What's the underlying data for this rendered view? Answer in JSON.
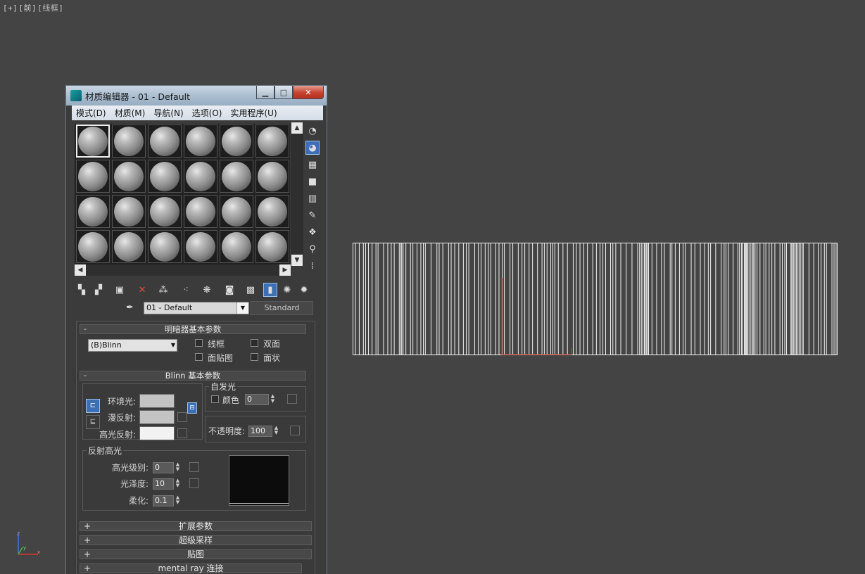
{
  "viewport": {
    "label_parts": [
      "[+]",
      "[前]",
      "[线框]"
    ]
  },
  "axis": {
    "z": "z",
    "y": "y",
    "x": "x"
  },
  "dialog": {
    "title": "材质编辑器 - 01 - Default",
    "menu": [
      "模式(D)",
      "材质(M)",
      "导航(N)",
      "选项(O)",
      "实用程序(U)"
    ],
    "material_name": "01 - Default",
    "material_type": "Standard",
    "shader_basic": {
      "header": "明暗器基本参数",
      "toggle": "-",
      "shader": "(B)Blinn",
      "options": {
        "wire": "线框",
        "two_sided": "双面",
        "face_map": "面贴图",
        "faceted": "面状"
      }
    },
    "blinn_basic": {
      "header": "Blinn 基本参数",
      "toggle": "-",
      "ambient_label": "环境光:",
      "diffuse_label": "漫反射:",
      "specular_label": "高光反射:",
      "ambient_color": "#c3c3c3",
      "diffuse_color": "#c3c3c3",
      "specular_color": "#f2f2f2",
      "self_illum": {
        "title": "自发光",
        "color_label": "颜色",
        "value": "0"
      },
      "opacity": {
        "label": "不透明度:",
        "value": "100"
      },
      "spec_highlights": {
        "title": "反射高光",
        "level_label": "高光级别:",
        "level_value": "0",
        "gloss_label": "光泽度:",
        "gloss_value": "10",
        "soften_label": "柔化:",
        "soften_value": "0.1"
      }
    },
    "collapsed_rollouts": [
      {
        "toggle": "+",
        "label": "扩展参数"
      },
      {
        "toggle": "+",
        "label": "超级采样"
      },
      {
        "toggle": "+",
        "label": "贴图"
      },
      {
        "toggle": "+",
        "label": "mental ray 连接"
      }
    ]
  }
}
